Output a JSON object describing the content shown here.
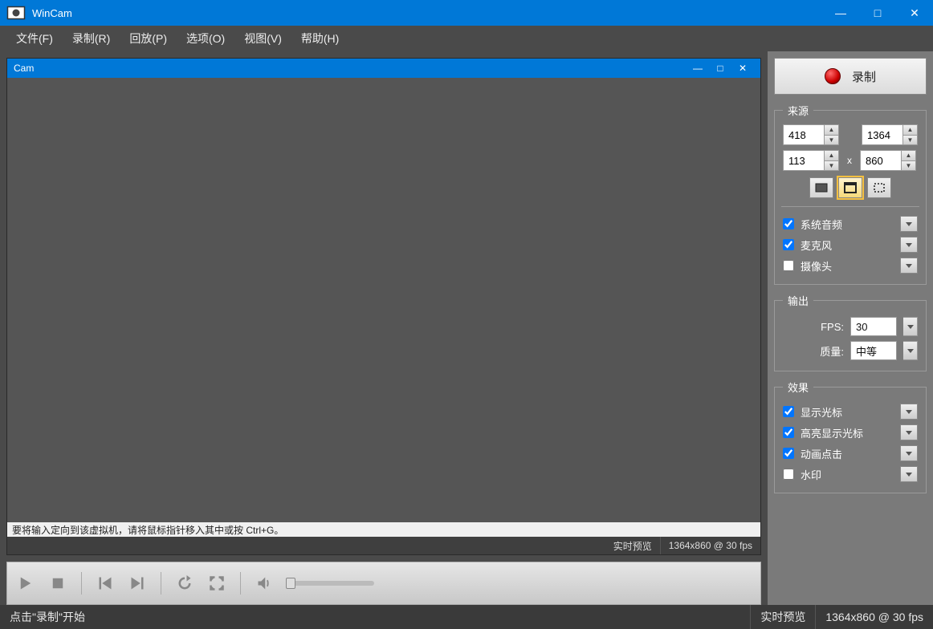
{
  "app": {
    "title": "WinCam"
  },
  "window_controls": {
    "min": "—",
    "max": "□",
    "close": "✕"
  },
  "menu": {
    "file": "文件(F)",
    "record": "录制(R)",
    "replay": "回放(P)",
    "options": "选项(O)",
    "view": "视图(V)",
    "help": "帮助(H)"
  },
  "nested": {
    "title": "Cam",
    "hint": "要将输入定向到该虚拟机，请将鼠标指针移入其中或按 Ctrl+G。",
    "preview_label": "实时预览",
    "preview_res": "1364x860 @ 30 fps"
  },
  "record_button": "录制",
  "source": {
    "legend": "来源",
    "w": "418",
    "h": "1364",
    "x": "113",
    "y": "860",
    "by": "x",
    "sys_audio": "系统音频",
    "mic": "麦克风",
    "camera": "摄像头",
    "sys_audio_checked": true,
    "mic_checked": true,
    "camera_checked": false
  },
  "output": {
    "legend": "输出",
    "fps_label": "FPS:",
    "fps_value": "30",
    "quality_label": "质量:",
    "quality_value": "中等"
  },
  "effects": {
    "legend": "效果",
    "cursor": "显示光标",
    "highlight_cursor": "高亮显示光标",
    "animate_click": "动画点击",
    "watermark": "水印",
    "cursor_checked": true,
    "highlight_cursor_checked": true,
    "animate_click_checked": true,
    "watermark_checked": false
  },
  "statusbar": {
    "hint": "点击\"录制\"开始",
    "preview": "实时预览",
    "resolution": "1364x860 @ 30 fps"
  }
}
